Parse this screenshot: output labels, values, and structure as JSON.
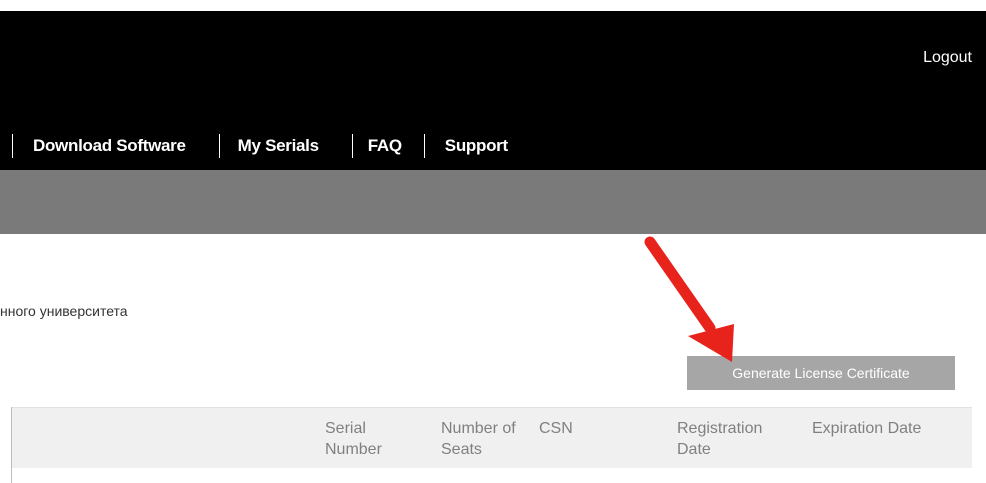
{
  "header": {
    "logout_label": "Logout"
  },
  "nav": {
    "items": [
      {
        "label": "Download Software"
      },
      {
        "label": "My Serials"
      },
      {
        "label": "FAQ"
      },
      {
        "label": "Support"
      }
    ]
  },
  "content": {
    "university_text": "нного университета",
    "generate_button_label": "Generate License Certificate"
  },
  "table": {
    "columns": [
      {
        "label": "Serial Number"
      },
      {
        "label": "Number of Seats"
      },
      {
        "label": "CSN"
      },
      {
        "label": "Registration Date"
      },
      {
        "label": "Expiration Date"
      }
    ]
  },
  "colors": {
    "topbar": "#000000",
    "graybar": "#7a7a7a",
    "button": "#a6a6a6",
    "arrow": "#e8231c"
  },
  "icons": {
    "annotation": "red-arrow-icon"
  }
}
